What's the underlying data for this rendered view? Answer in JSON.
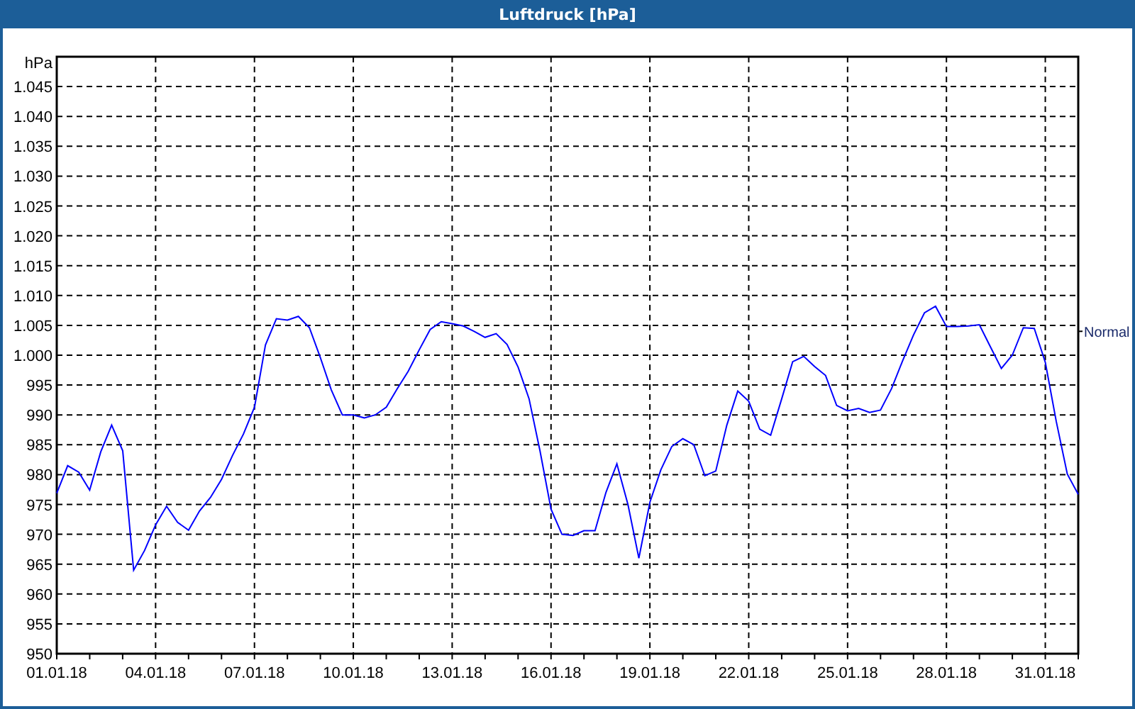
{
  "window": {
    "title": "Luftdruck [hPa]"
  },
  "chart": {
    "chart_data": {
      "type": "line",
      "ylabel": "hPa",
      "ylim": [
        950,
        1050
      ],
      "yticks": [
        {
          "value": 950,
          "label": "950"
        },
        {
          "value": 955,
          "label": "955"
        },
        {
          "value": 960,
          "label": "960"
        },
        {
          "value": 965,
          "label": "965"
        },
        {
          "value": 970,
          "label": "970"
        },
        {
          "value": 975,
          "label": "975"
        },
        {
          "value": 980,
          "label": "980"
        },
        {
          "value": 985,
          "label": "985"
        },
        {
          "value": 990,
          "label": "990"
        },
        {
          "value": 995,
          "label": "995"
        },
        {
          "value": 1000,
          "label": "1.000"
        },
        {
          "value": 1005,
          "label": "1.005"
        },
        {
          "value": 1010,
          "label": "1.010"
        },
        {
          "value": 1015,
          "label": "1.015"
        },
        {
          "value": 1020,
          "label": "1.020"
        },
        {
          "value": 1025,
          "label": "1.025"
        },
        {
          "value": 1030,
          "label": "1.030"
        },
        {
          "value": 1035,
          "label": "1.035"
        },
        {
          "value": 1040,
          "label": "1.040"
        },
        {
          "value": 1045,
          "label": "1.045"
        }
      ],
      "categories": [
        "01.01.18",
        null,
        null,
        null,
        null,
        null,
        null,
        null,
        null,
        "04.01.18",
        null,
        null,
        null,
        null,
        null,
        null,
        null,
        null,
        "07.01.18",
        null,
        null,
        null,
        null,
        null,
        null,
        null,
        null,
        "10.01.18",
        null,
        null,
        null,
        null,
        null,
        null,
        null,
        null,
        "13.01.18",
        null,
        null,
        null,
        null,
        null,
        null,
        null,
        null,
        "16.01.18",
        null,
        null,
        null,
        null,
        null,
        null,
        null,
        null,
        "19.01.18",
        null,
        null,
        null,
        null,
        null,
        null,
        null,
        null,
        "22.01.18",
        null,
        null,
        null,
        null,
        null,
        null,
        null,
        null,
        "25.01.18",
        null,
        null,
        null,
        null,
        null,
        null,
        null,
        null,
        "28.01.18",
        null,
        null,
        null,
        null,
        null,
        null,
        null,
        null,
        "31.01.18",
        null,
        null,
        null
      ],
      "series": [
        {
          "color": "#0000ff",
          "values": [
            976.9,
            981.5,
            980.4,
            977.4,
            983.8,
            988.3,
            984,
            964,
            967.3,
            971.6,
            974.7,
            972,
            970.7,
            973.9,
            976.2,
            979.2,
            983.2,
            986.8,
            991.3,
            1001.7,
            1006.1,
            1005.9,
            1006.5,
            1004.6,
            999.6,
            994.2,
            990,
            990,
            989.5,
            990,
            991.3,
            994.4,
            997.3,
            1000.9,
            1004.3,
            1005.6,
            1005.3,
            1004.9,
            1004,
            1003,
            1003.6,
            1001.8,
            998,
            992.7,
            984,
            974.2,
            970,
            969.8,
            970.6,
            970.6,
            977,
            981.8,
            975,
            966,
            975.4,
            980.8,
            984.7,
            986,
            985,
            979.8,
            980.6,
            988.3,
            994,
            992.3,
            987.6,
            986.6,
            992.7,
            998.9,
            999.8,
            998.1,
            996.6,
            991.6,
            990.7,
            991.1,
            990.4,
            990.8,
            994.4,
            999,
            1003.4,
            1007.1,
            1008.2,
            1004.8,
            1004.8,
            1004.9,
            1005.1,
            1001.4,
            997.8,
            1000,
            1004.6,
            1004.5,
            998.8,
            988.9,
            980.1,
            976.7
          ]
        }
      ],
      "grid": true,
      "annotations": [
        "Normal"
      ]
    }
  }
}
